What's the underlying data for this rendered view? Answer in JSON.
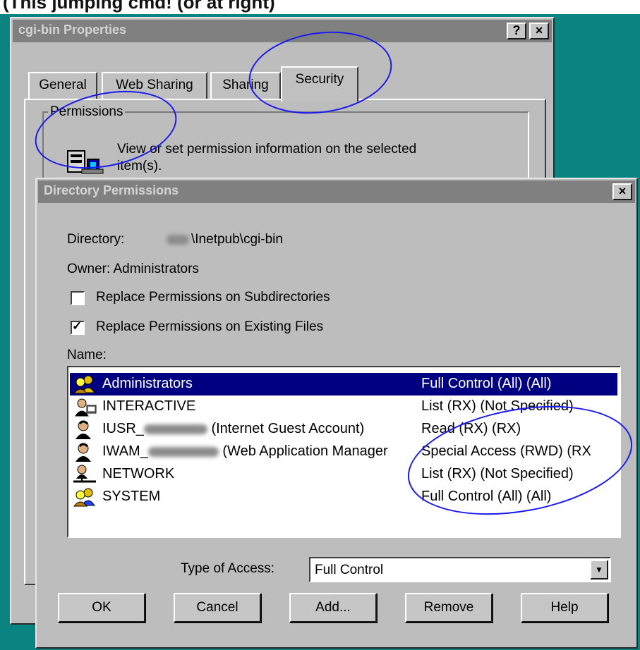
{
  "page_caption": "(This jumping cmd! (or at right)",
  "properties_window": {
    "title": "cgi-bin Properties",
    "help_button": "?",
    "close_button": "×",
    "tabs": [
      {
        "label": "General",
        "active": false
      },
      {
        "label": "Web Sharing",
        "active": false
      },
      {
        "label": "Sharing",
        "active": false
      },
      {
        "label": "Security",
        "active": true
      }
    ],
    "permissions_group": {
      "label": "Permissions",
      "description": "View or set permission information on the selected item(s).",
      "icon": "permissions-key-icon"
    }
  },
  "dialog": {
    "title": "Directory Permissions",
    "close_button": "×",
    "directory_label": "Directory:",
    "directory_value": "\\Inetpub\\cgi-bin",
    "owner_text": "Owner: Administrators",
    "replace_subdirs_label": "Replace Permissions on Subdirectories",
    "replace_subdirs_checked": false,
    "replace_files_label": "Replace Permissions on Existing Files",
    "replace_files_checked": true,
    "name_label": "Name:",
    "entries": [
      {
        "name": "Administrators",
        "suffix": "",
        "access": "Full Control (All) (All)",
        "icon": "group-icon",
        "selected": true
      },
      {
        "name": "INTERACTIVE",
        "suffix": "",
        "access": "List (RX) (Not Specified)",
        "icon": "interactive-icon",
        "selected": false
      },
      {
        "name": "IUSR_",
        "suffix": "(Internet Guest Account)",
        "access": "Read (RX) (RX)",
        "icon": "user-icon",
        "selected": false
      },
      {
        "name": "IWAM_",
        "suffix": "(Web Application Manager",
        "access": "Special Access (RWD) (RX",
        "icon": "user-icon",
        "selected": false
      },
      {
        "name": "NETWORK",
        "suffix": "",
        "access": "List (RX) (Not Specified)",
        "icon": "network-icon",
        "selected": false
      },
      {
        "name": "SYSTEM",
        "suffix": "",
        "access": "Full Control (All) (All)",
        "icon": "group-icon",
        "selected": false
      }
    ],
    "type_of_access_label": "Type of Access:",
    "type_of_access_value": "Full Control",
    "buttons": {
      "ok": "OK",
      "cancel": "Cancel",
      "add": "Add...",
      "remove": "Remove",
      "help": "Help"
    }
  },
  "colors": {
    "desktop": "#0a8480",
    "window_face": "#bdbdbd",
    "selection": "#000080",
    "annotation": "#1a1aee"
  }
}
